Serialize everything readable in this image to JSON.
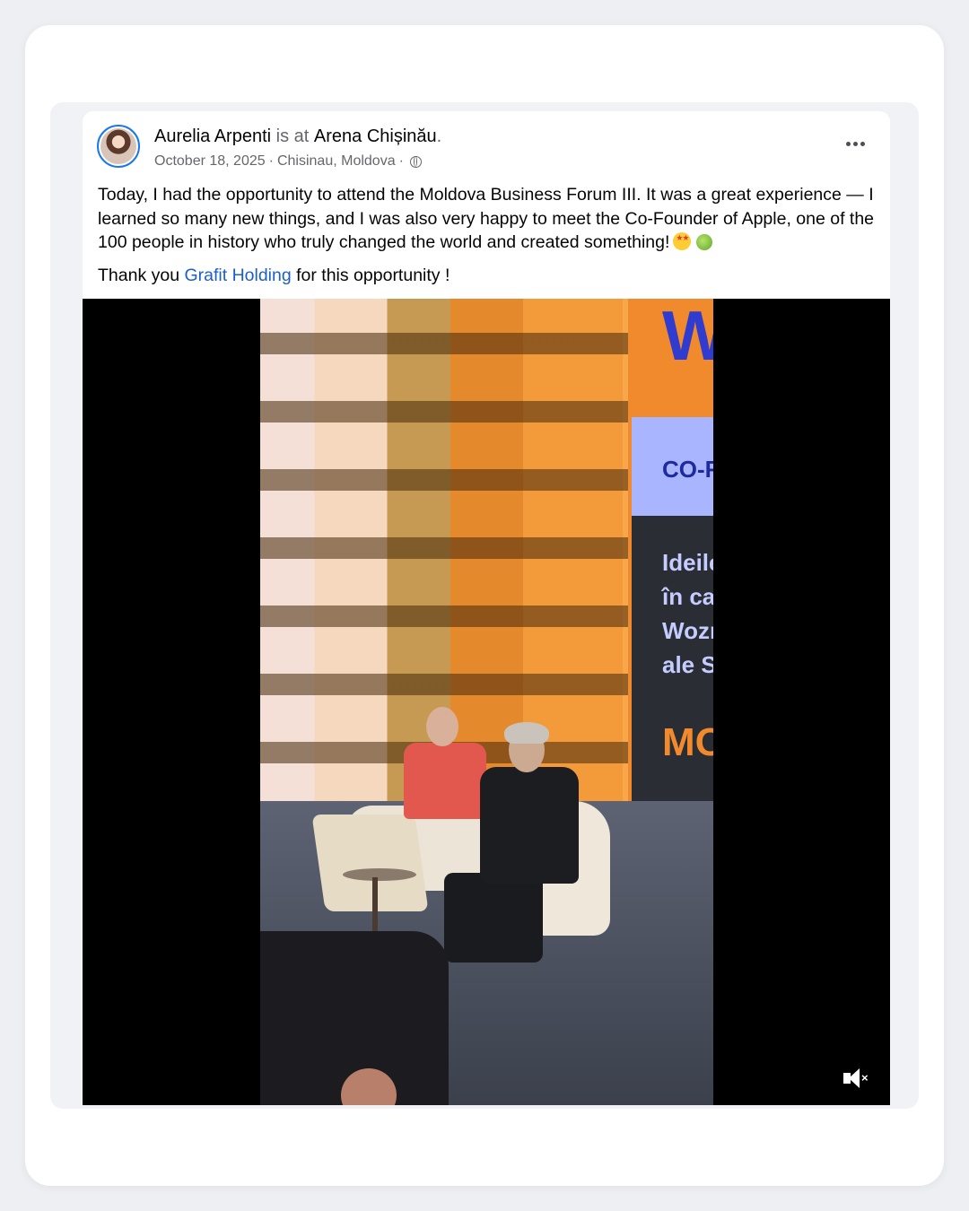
{
  "post": {
    "author": "Aurelia Arpenti",
    "is_at": "is at",
    "location": "Arena Chișinău",
    "period": ".",
    "date": "October 18, 2025",
    "place": "Chisinau, Moldova",
    "separator": "·",
    "text_paragraph_1": "Today, I had the opportunity to attend the Moldova Business Forum III. It was a great experience — I learned so many new things, and I was also very happy to meet the Co-Founder of Apple, one of the 100 people in history who truly changed the world and created something!",
    "text_paragraph_2_prefix": "Thank you",
    "mention": "Grafit Holding",
    "text_paragraph_2_suffix": "for this opportunity !"
  },
  "video": {
    "screen_text_top": "W",
    "screen_text_cofounder": "CO-FOU",
    "screen_text_body": [
      "Ideile sa",
      "în care l",
      "Woznial",
      "ale Silic"
    ],
    "screen_text_bottom": "MOL"
  },
  "icons": {
    "audience": "globe-icon",
    "more": "more-options-icon",
    "sound": "mute-icon",
    "emojis": [
      "star-struck-emoji",
      "green-apple-emoji"
    ]
  },
  "colors": {
    "link": "#1d5fc9",
    "avatar_ring": "#1877f2",
    "background": "#eeeff2"
  }
}
